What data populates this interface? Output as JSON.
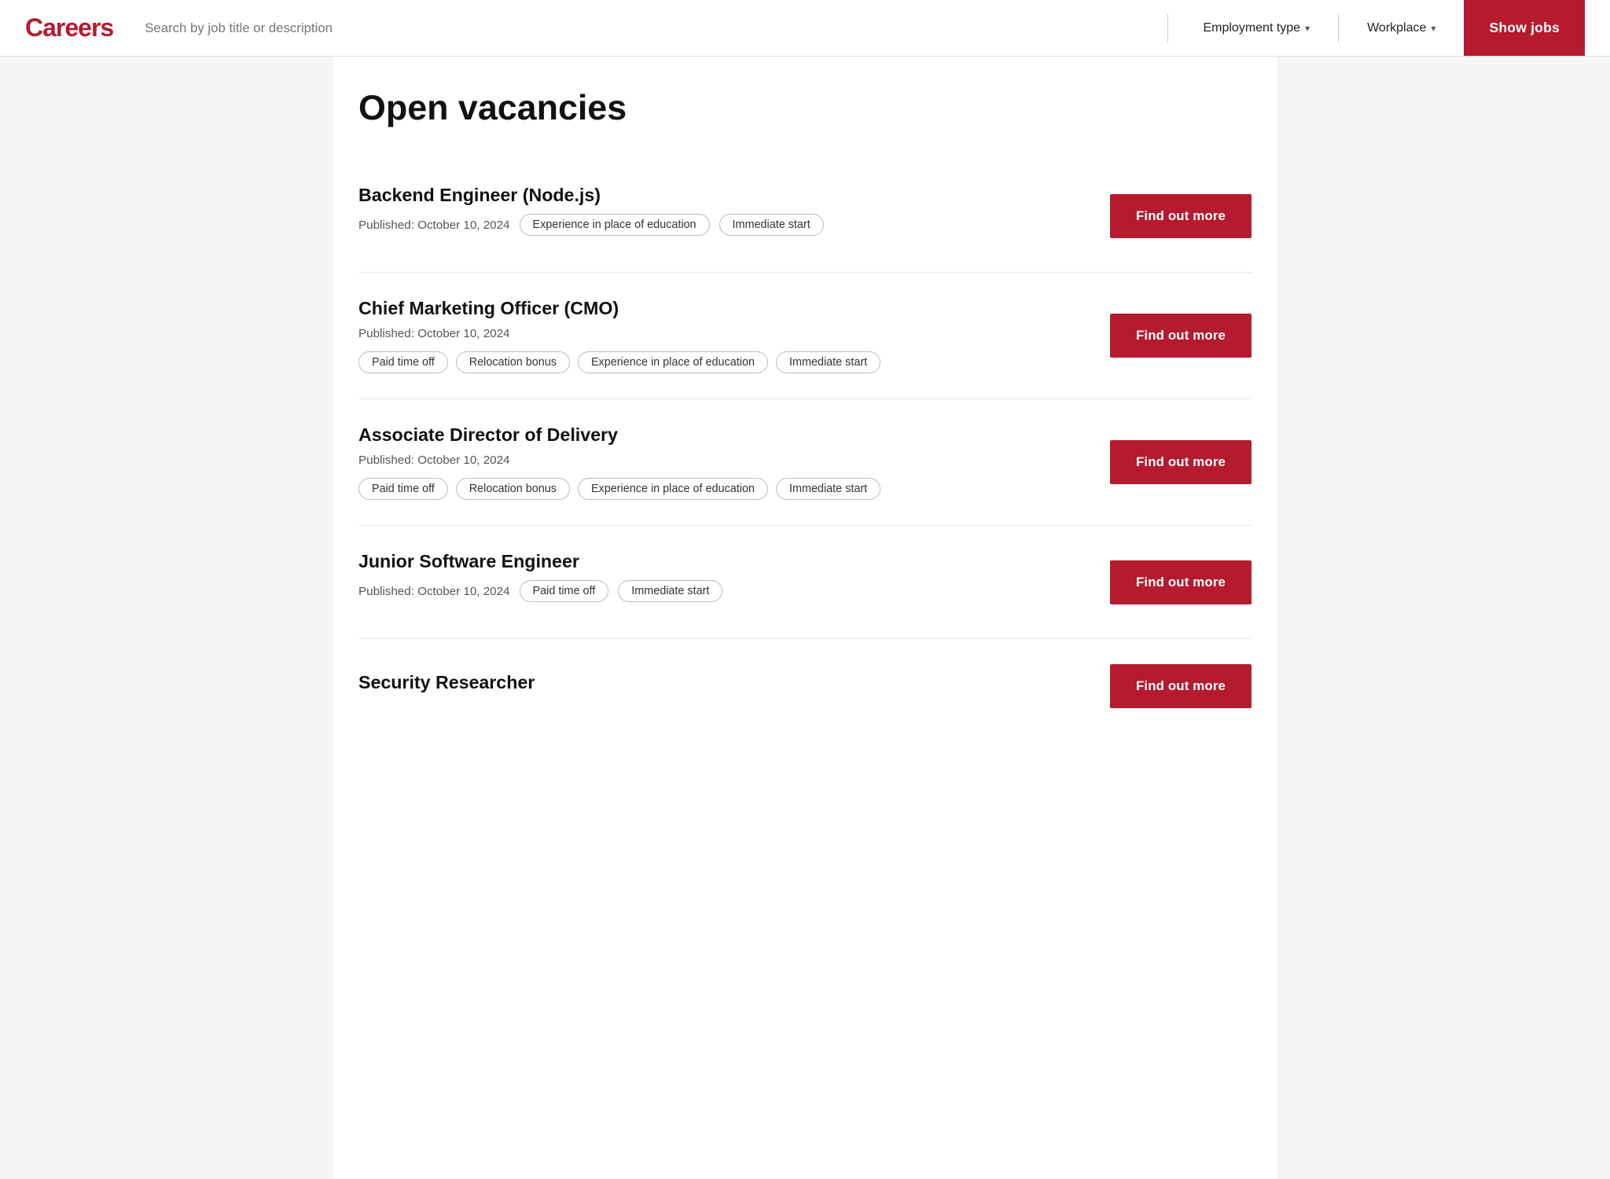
{
  "header": {
    "logo": "Careers",
    "search_placeholder": "Search by job title or description",
    "employment_type_label": "Employment type",
    "workplace_label": "Workplace",
    "show_jobs_label": "Show jobs"
  },
  "page": {
    "title": "Open vacancies"
  },
  "jobs": [
    {
      "title": "Backend Engineer (Node.js)",
      "published": "Published: October 10, 2024",
      "tags_inline": [
        "Experience in place of education",
        "Immediate start"
      ],
      "tags_row": [],
      "button_label": "Find out more"
    },
    {
      "title": "Chief Marketing Officer (CMO)",
      "published": "Published: October 10, 2024",
      "tags_inline": [],
      "tags_row": [
        "Paid time off",
        "Relocation bonus",
        "Experience in place of education",
        "Immediate start"
      ],
      "button_label": "Find out more"
    },
    {
      "title": "Associate Director of Delivery",
      "published": "Published: October 10, 2024",
      "tags_inline": [],
      "tags_row": [
        "Paid time off",
        "Relocation bonus",
        "Experience in place of education",
        "Immediate start"
      ],
      "button_label": "Find out more"
    },
    {
      "title": "Junior Software Engineer",
      "published": "Published: October 10, 2024",
      "tags_inline": [
        "Paid time off",
        "Immediate start"
      ],
      "tags_row": [],
      "button_label": "Find out more"
    },
    {
      "title": "Security Researcher",
      "published": "",
      "tags_inline": [],
      "tags_row": [],
      "button_label": "Find out more",
      "partial": true
    }
  ],
  "colors": {
    "brand_red": "#b51a2e"
  }
}
